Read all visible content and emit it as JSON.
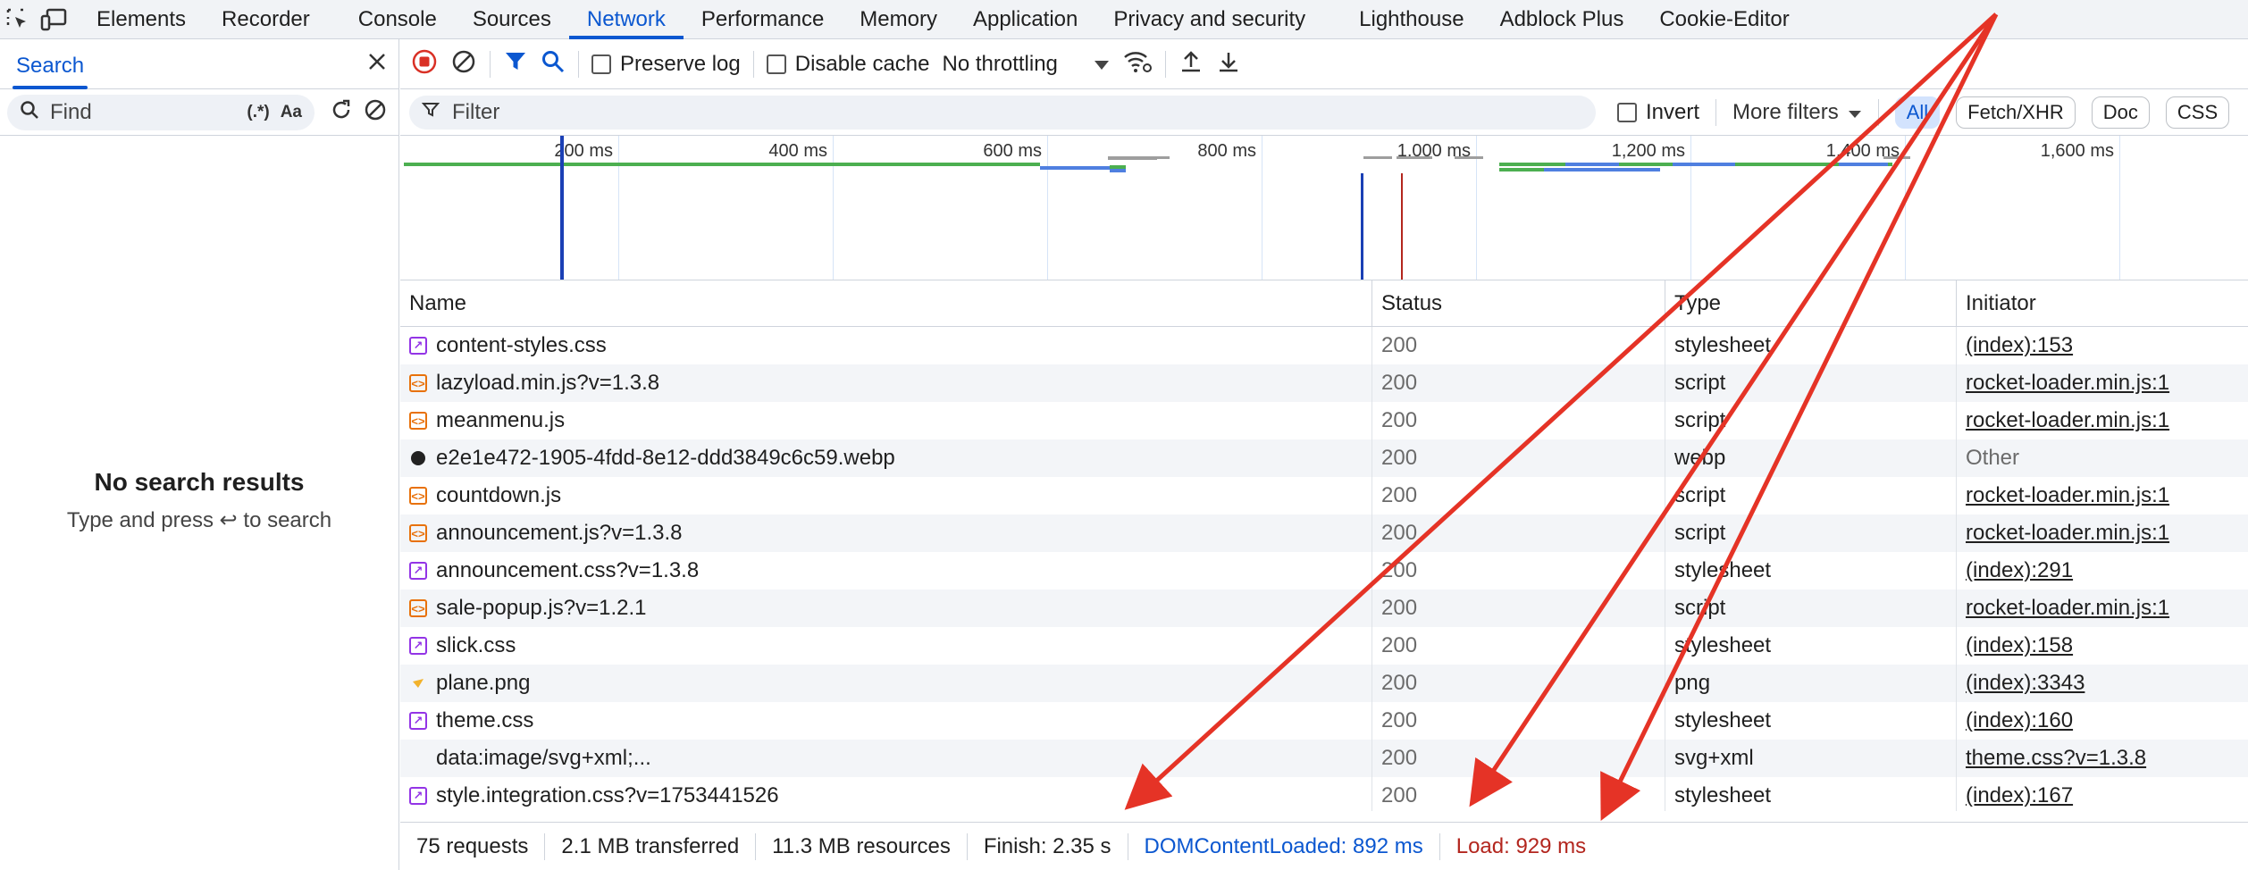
{
  "tabs": [
    "Elements",
    "Recorder",
    "Console",
    "Sources",
    "Network",
    "Performance",
    "Memory",
    "Application",
    "Privacy and security",
    "Lighthouse",
    "Adblock Plus",
    "Cookie-Editor"
  ],
  "active_tab": "Network",
  "search_panel": {
    "title": "Search",
    "find_placeholder": "Find",
    "regex_label": "(.*)",
    "case_label": "Aa",
    "empty_title": "No search results",
    "empty_hint": "Type and press ↩ to search"
  },
  "toolbar": {
    "preserve_log": "Preserve log",
    "disable_cache": "Disable cache",
    "throttling": "No throttling"
  },
  "filterbar": {
    "filter_placeholder": "Filter",
    "invert": "Invert",
    "more_filters": "More filters",
    "all": "All",
    "fetch_xhr": "Fetch/XHR",
    "doc": "Doc",
    "css": "CSS"
  },
  "overview": {
    "ticks": [
      "200 ms",
      "400 ms",
      "600 ms",
      "800 ms",
      "1,000 ms",
      "1,200 ms",
      "1,400 ms",
      "1,600 ms"
    ],
    "tick_values": [
      200,
      400,
      600,
      800,
      1000,
      1200,
      1400,
      1600
    ],
    "dom_content_loaded_ms": 892,
    "load_ms": 929
  },
  "table": {
    "columns": [
      "Name",
      "Status",
      "Type",
      "Initiator"
    ],
    "rows": [
      {
        "name": "content-styles.css",
        "status": "200",
        "type": "stylesheet",
        "initiator": "(index):153",
        "kind": "css",
        "link": true
      },
      {
        "name": "lazyload.min.js?v=1.3.8",
        "status": "200",
        "type": "script",
        "initiator": "rocket-loader.min.js:1",
        "kind": "js",
        "link": true
      },
      {
        "name": "meanmenu.js",
        "status": "200",
        "type": "script",
        "initiator": "rocket-loader.min.js:1",
        "kind": "js",
        "link": true
      },
      {
        "name": "e2e1e472-1905-4fdd-8e12-ddd3849c6c59.webp",
        "status": "200",
        "type": "webp",
        "initiator": "Other",
        "kind": "img",
        "link": false
      },
      {
        "name": "countdown.js",
        "status": "200",
        "type": "script",
        "initiator": "rocket-loader.min.js:1",
        "kind": "js",
        "link": true
      },
      {
        "name": "announcement.js?v=1.3.8",
        "status": "200",
        "type": "script",
        "initiator": "rocket-loader.min.js:1",
        "kind": "js",
        "link": true
      },
      {
        "name": "announcement.css?v=1.3.8",
        "status": "200",
        "type": "stylesheet",
        "initiator": "(index):291",
        "kind": "css",
        "link": true
      },
      {
        "name": "sale-popup.js?v=1.2.1",
        "status": "200",
        "type": "script",
        "initiator": "rocket-loader.min.js:1",
        "kind": "js",
        "link": true
      },
      {
        "name": "slick.css",
        "status": "200",
        "type": "stylesheet",
        "initiator": "(index):158",
        "kind": "css",
        "link": true
      },
      {
        "name": "plane.png",
        "status": "200",
        "type": "png",
        "initiator": "(index):3343",
        "kind": "png",
        "link": true
      },
      {
        "name": "theme.css",
        "status": "200",
        "type": "stylesheet",
        "initiator": "(index):160",
        "kind": "css",
        "link": true
      },
      {
        "name": "data:image/svg+xml;...",
        "status": "200",
        "type": "svg+xml",
        "initiator": "theme.css?v=1.3.8",
        "kind": "none",
        "link": true
      },
      {
        "name": "style.integration.css?v=1753441526",
        "status": "200",
        "type": "stylesheet",
        "initiator": "(index):167",
        "kind": "css",
        "link": true
      }
    ]
  },
  "statusbar": {
    "requests": "75 requests",
    "transferred": "2.1 MB transferred",
    "resources": "11.3 MB resources",
    "finish": "Finish: 2.35 s",
    "dcl": "DOMContentLoaded: 892 ms",
    "load": "Load: 929 ms"
  },
  "colors": {
    "accent": "#0b57d0",
    "dcl_line": "#1a3fb5",
    "load_line": "#b3261e",
    "arrow": "#e53326"
  }
}
